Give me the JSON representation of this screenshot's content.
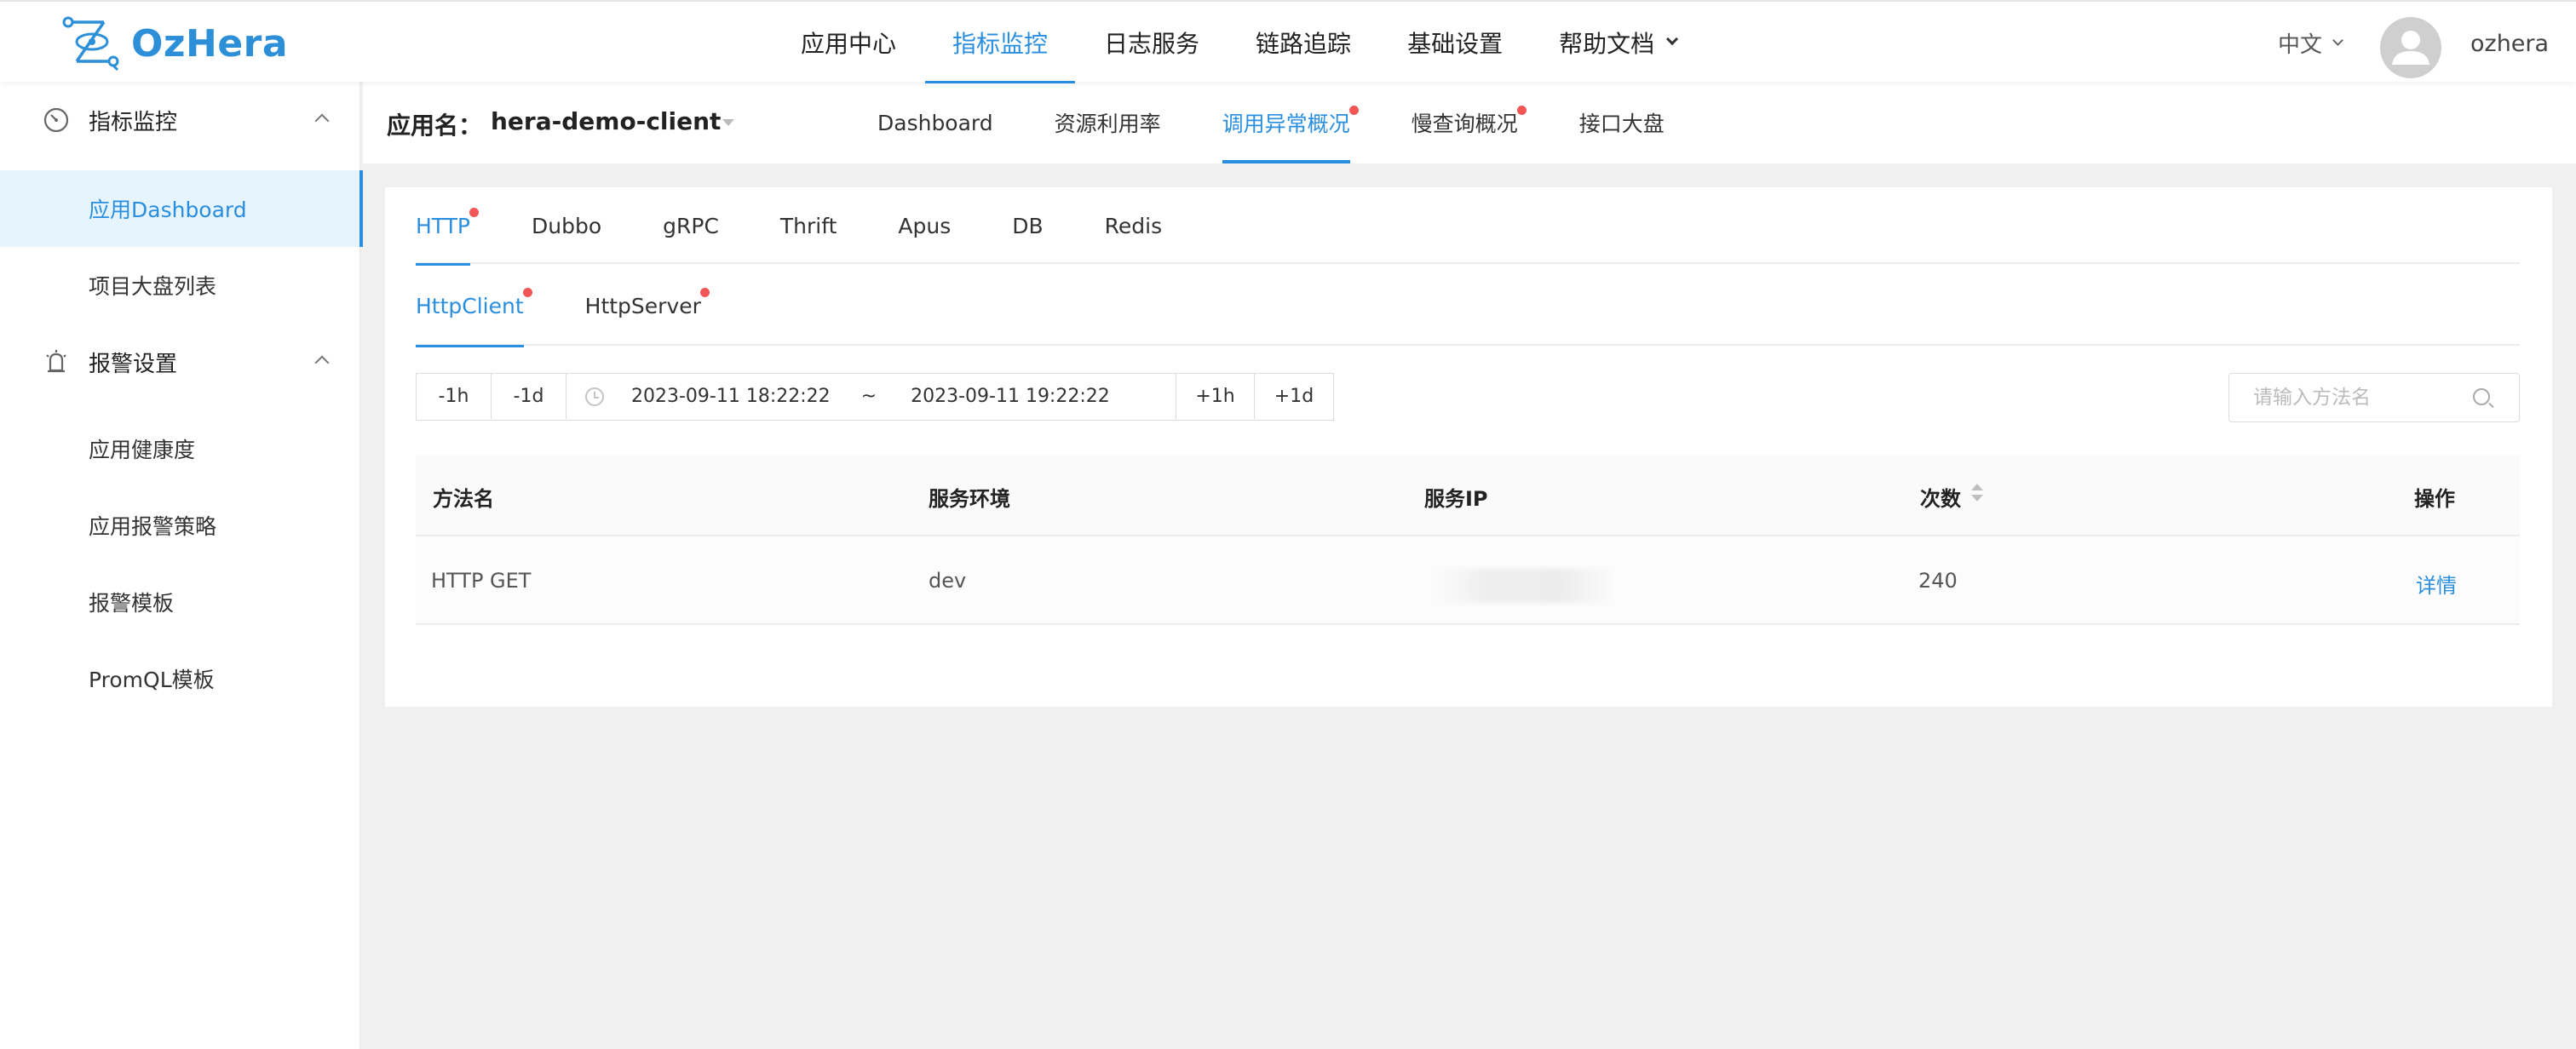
{
  "brand": {
    "name": "OzHera",
    "color": "#2c8fd8"
  },
  "top_nav": {
    "items": [
      {
        "label": "应用中心",
        "active": false
      },
      {
        "label": "指标监控",
        "active": true
      },
      {
        "label": "日志服务",
        "active": false
      },
      {
        "label": "链路追踪",
        "active": false
      },
      {
        "label": "基础设置",
        "active": false
      },
      {
        "label": "帮助文档",
        "active": false,
        "has_dropdown": true
      }
    ],
    "language": "中文",
    "username": "ozhera"
  },
  "sidebar": {
    "groups": [
      {
        "label": "指标监控",
        "icon": "gauge-icon",
        "expanded": true,
        "items": [
          {
            "label": "应用Dashboard",
            "active": true
          },
          {
            "label": "项目大盘列表",
            "active": false
          }
        ]
      },
      {
        "label": "报警设置",
        "icon": "alarm-icon",
        "expanded": true,
        "items": [
          {
            "label": "应用健康度",
            "active": false
          },
          {
            "label": "应用报警策略",
            "active": false
          },
          {
            "label": "报警模板",
            "active": false
          },
          {
            "label": "PromQL模板",
            "active": false
          }
        ]
      }
    ]
  },
  "subheader": {
    "app_label": "应用名：",
    "app_name": "hera-demo-client",
    "tabs": [
      {
        "label": "Dashboard",
        "active": false,
        "dot": false
      },
      {
        "label": "资源利用率",
        "active": false,
        "dot": false
      },
      {
        "label": "调用异常概况",
        "active": true,
        "dot": true
      },
      {
        "label": "慢查询概况",
        "active": false,
        "dot": true
      },
      {
        "label": "接口大盘",
        "active": false,
        "dot": false
      }
    ]
  },
  "protocol_tabs": [
    {
      "label": "HTTP",
      "active": true,
      "dot": true
    },
    {
      "label": "Dubbo",
      "active": false,
      "dot": false
    },
    {
      "label": "gRPC",
      "active": false,
      "dot": false
    },
    {
      "label": "Thrift",
      "active": false,
      "dot": false
    },
    {
      "label": "Apus",
      "active": false,
      "dot": false
    },
    {
      "label": "DB",
      "active": false,
      "dot": false
    },
    {
      "label": "Redis",
      "active": false,
      "dot": false
    }
  ],
  "http_tabs": [
    {
      "label": "HttpClient",
      "active": true,
      "dot": true
    },
    {
      "label": "HttpServer",
      "active": false,
      "dot": true
    }
  ],
  "time_filter": {
    "minus_hour": "-1h",
    "minus_day": "-1d",
    "start": "2023-09-11 18:22:22",
    "separator": "~",
    "end": "2023-09-11 19:22:22",
    "plus_hour": "+1h",
    "plus_day": "+1d"
  },
  "search": {
    "placeholder": "请输入方法名",
    "value": ""
  },
  "table": {
    "columns": [
      "方法名",
      "服务环境",
      "服务IP",
      "次数",
      "操作"
    ],
    "rows": [
      {
        "method": "HTTP GET",
        "env": "dev",
        "ip": "",
        "count": "240",
        "action": "详情"
      }
    ]
  },
  "colors": {
    "accent": "#2a8ee0",
    "badge_dot": "#f25656",
    "active_bg": "#e6f4fd"
  }
}
